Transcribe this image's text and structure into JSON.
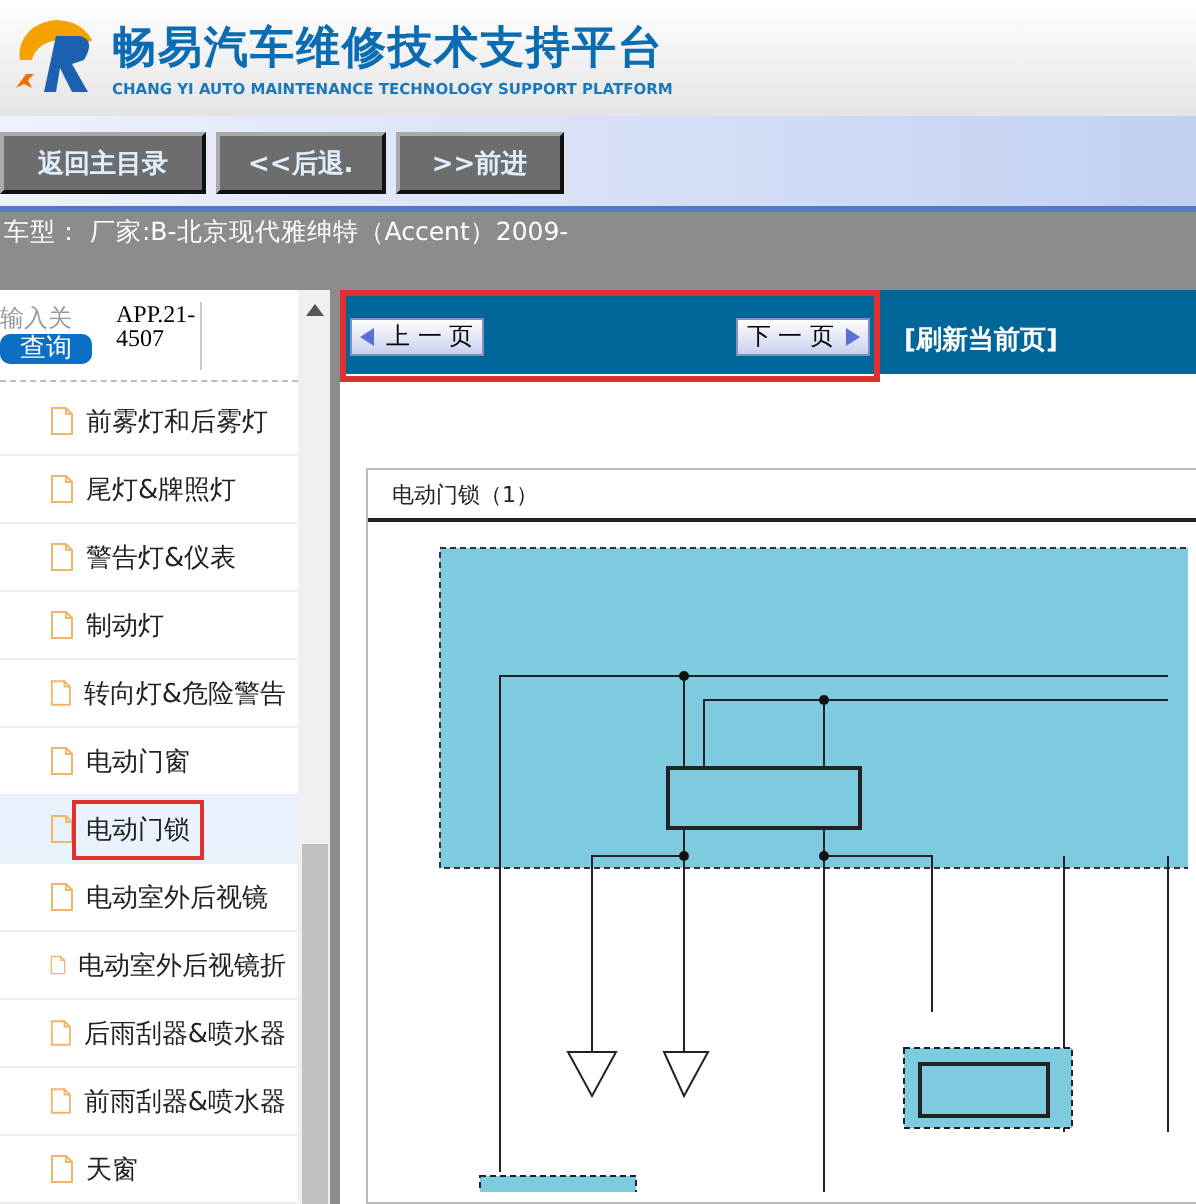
{
  "header": {
    "title": "畅易汽车维修技术支持平台",
    "subtitle": "CHANG YI AUTO MAINTENANCE TECHNOLOGY SUPPORT PLATFORM"
  },
  "nav_buttons": [
    "返回主目录",
    "<<后退.",
    ">>前进"
  ],
  "vehicle_bar": {
    "text": "车型：  厂家:B-北京现代雅绅特（Accent）2009-"
  },
  "sidebar": {
    "search": {
      "placeholder": "输入关",
      "button": "查询"
    },
    "code": "APP.21-4507",
    "items": [
      {
        "label": "前雾灯和后雾灯",
        "selected": false,
        "highlighted": false
      },
      {
        "label": "尾灯&牌照灯",
        "selected": false,
        "highlighted": false
      },
      {
        "label": "警告灯&仪表",
        "selected": false,
        "highlighted": false
      },
      {
        "label": "制动灯",
        "selected": false,
        "highlighted": false
      },
      {
        "label": "转向灯&危险警告",
        "selected": false,
        "highlighted": false
      },
      {
        "label": "电动门窗",
        "selected": false,
        "highlighted": false
      },
      {
        "label": "电动门锁",
        "selected": true,
        "highlighted": true
      },
      {
        "label": "电动室外后视镜",
        "selected": false,
        "highlighted": false
      },
      {
        "label": "电动室外后视镜折",
        "selected": false,
        "highlighted": false
      },
      {
        "label": "后雨刮器&喷水器",
        "selected": false,
        "highlighted": false
      },
      {
        "label": "前雨刮器&喷水器",
        "selected": false,
        "highlighted": false
      },
      {
        "label": "天窗",
        "selected": false,
        "highlighted": false
      }
    ]
  },
  "viewer": {
    "prev_button": "上 一 页",
    "next_button": "下 一 页",
    "paging_highlighted": true,
    "refresh_link": "[刷新当前页]",
    "caption": "电动门锁（1）"
  }
}
